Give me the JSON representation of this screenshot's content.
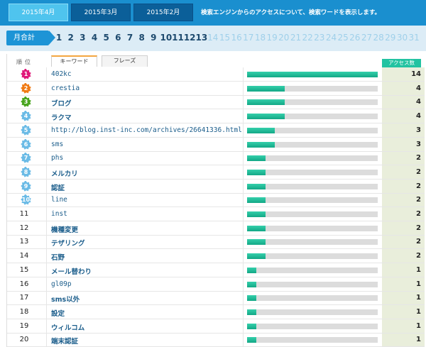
{
  "month_tabs": [
    {
      "label": "2015年4月",
      "active": true
    },
    {
      "label": "2015年3月",
      "active": false
    },
    {
      "label": "2015年2月",
      "active": false
    }
  ],
  "notice": "検索エンジンからのアクセスについて、検索ワードを表示します。",
  "days_bar": {
    "monthly_label": "月合計",
    "days": [
      "1",
      "2",
      "3",
      "4",
      "5",
      "6",
      "7",
      "8",
      "9",
      "10",
      "11",
      "12",
      "13",
      "14",
      "15",
      "16",
      "17",
      "18",
      "19",
      "20",
      "21",
      "22",
      "23",
      "24",
      "25",
      "26",
      "27",
      "28",
      "29",
      "30",
      "31"
    ],
    "last_active_day": 13
  },
  "table": {
    "rank_header": "順位",
    "tabs": [
      {
        "label": "キーワード",
        "active": true
      },
      {
        "label": "フレーズ",
        "active": false
      }
    ],
    "count_header": "アクセス数",
    "max_count": 14,
    "rows": [
      {
        "rank": "1",
        "keyword": "402kc",
        "count": 14,
        "badge_color": "#e0197a"
      },
      {
        "rank": "2",
        "keyword": "crestia",
        "count": 4,
        "badge_color": "#f07a14"
      },
      {
        "rank": "3",
        "keyword": "ブログ",
        "count": 4,
        "badge_color": "#4aa51f"
      },
      {
        "rank": "4",
        "keyword": "ラクマ",
        "count": 4,
        "badge_color": "#6bbbe6"
      },
      {
        "rank": "5",
        "keyword": "http://blog.inst-inc.com/archives/26641336.html",
        "count": 3,
        "badge_color": "#6bbbe6"
      },
      {
        "rank": "6",
        "keyword": "sms",
        "count": 3,
        "badge_color": "#6bbbe6"
      },
      {
        "rank": "7",
        "keyword": "phs",
        "count": 2,
        "badge_color": "#6bbbe6"
      },
      {
        "rank": "8",
        "keyword": "メルカリ",
        "count": 2,
        "badge_color": "#6bbbe6"
      },
      {
        "rank": "9",
        "keyword": "認証",
        "count": 2,
        "badge_color": "#6bbbe6"
      },
      {
        "rank": "10",
        "keyword": "line",
        "count": 2,
        "badge_color": "#6bbbe6"
      },
      {
        "rank": "11",
        "keyword": "inst",
        "count": 2
      },
      {
        "rank": "12",
        "keyword": "機種変更",
        "count": 2
      },
      {
        "rank": "13",
        "keyword": "テザリング",
        "count": 2
      },
      {
        "rank": "14",
        "keyword": "石野",
        "count": 2
      },
      {
        "rank": "15",
        "keyword": "メール替わり",
        "count": 1
      },
      {
        "rank": "16",
        "keyword": "gl09p",
        "count": 1
      },
      {
        "rank": "17",
        "keyword": "sms以外",
        "count": 1
      },
      {
        "rank": "18",
        "keyword": "設定",
        "count": 1
      },
      {
        "rank": "19",
        "keyword": "ウィルコム",
        "count": 1
      },
      {
        "rank": "20",
        "keyword": "端末認証",
        "count": 1
      }
    ]
  }
}
